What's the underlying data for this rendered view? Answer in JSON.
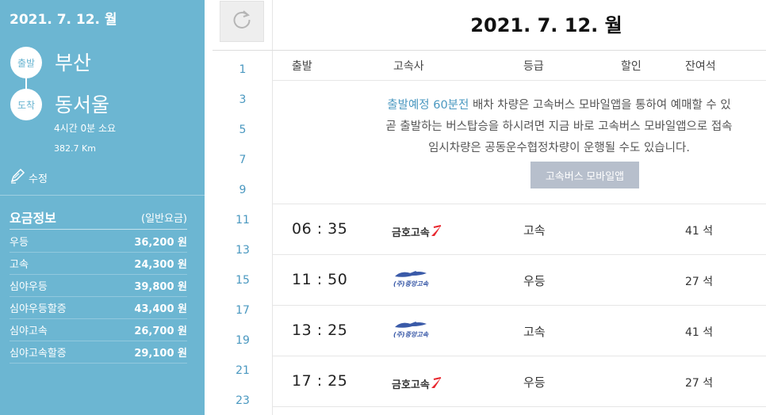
{
  "sidebar": {
    "date": "2021. 7. 12. 월",
    "departure_label": "출발",
    "departure_city": "부산",
    "arrival_label": "도착",
    "arrival_city": "동서울",
    "duration": "4시간 0분 소요",
    "distance": "382.7 Km",
    "edit_label": "수정",
    "fare_title": "요금정보",
    "fare_subtitle": "(일반요금)",
    "fares": [
      {
        "grade": "우등",
        "price": "36,200 원"
      },
      {
        "grade": "고속",
        "price": "24,300 원"
      },
      {
        "grade": "심야우등",
        "price": "39,800 원"
      },
      {
        "grade": "심야우등할증",
        "price": "43,400 원"
      },
      {
        "grade": "심야고속",
        "price": "26,700 원"
      },
      {
        "grade": "심야고속할증",
        "price": "29,100 원"
      }
    ]
  },
  "hours": [
    "1",
    "3",
    "5",
    "7",
    "9",
    "11",
    "13",
    "15",
    "17",
    "19",
    "21",
    "23"
  ],
  "main": {
    "title": "2021. 7. 12. 월",
    "columns": [
      "출발",
      "고속사",
      "등급",
      "할인",
      "잔여석"
    ],
    "notice": {
      "highlight": "출발예정 60분전",
      "line1_rest": " 배차 차량은 고속버스 모바일앱을 통하여 예매할 수 있",
      "line2": "곧 출발하는 버스탑승을 하시려면 지금 바로 고속버스 모바일앱으로 접속",
      "line3": "임시차량은 공동운수협정차량이 운행될 수도 있습니다."
    },
    "app_button": "고속버스 모바일앱",
    "schedules": [
      {
        "time": "06 : 35",
        "company": "금호고속",
        "grade": "고속",
        "seats": "41 석"
      },
      {
        "time": "11 : 50",
        "company": "(주)중앙고속",
        "grade": "우등",
        "seats": "27 석"
      },
      {
        "time": "13 : 25",
        "company": "(주)중앙고속",
        "grade": "고속",
        "seats": "41 석"
      },
      {
        "time": "17 : 25",
        "company": "금호고속",
        "grade": "우등",
        "seats": "27 석"
      }
    ]
  },
  "colors": {
    "sidebar_bg": "#6cb6d2",
    "accent": "#4a98c0",
    "button_bg": "#b7bfcc",
    "kumho_red": "#e8262d"
  },
  "icons": {
    "refresh": "refresh-icon",
    "edit": "pencil-icon"
  }
}
